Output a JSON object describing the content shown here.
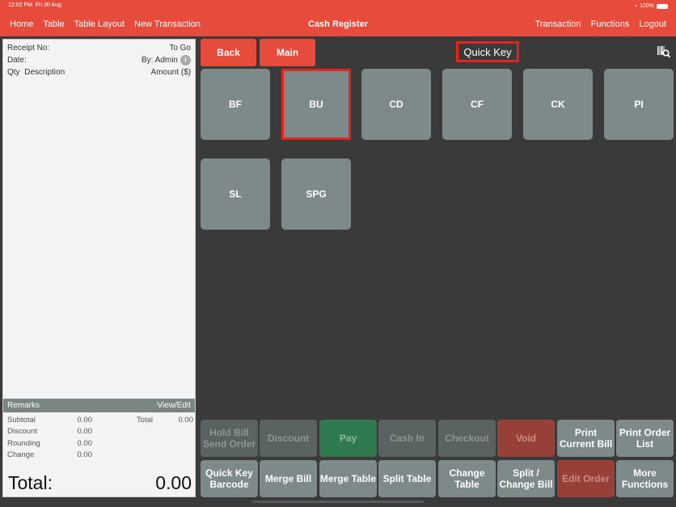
{
  "status_bar": {
    "time": "12:02 PM",
    "date": "Fri 30 Aug",
    "battery": "100%"
  },
  "nav": {
    "left": [
      "Home",
      "Table",
      "Table Layout",
      "New Transaction"
    ],
    "title": "Cash Register",
    "right": [
      "Transaction",
      "Functions",
      "Logout"
    ]
  },
  "receipt": {
    "receipt_no_label": "Receipt No:",
    "order_type": "To Go",
    "date_label": "Date:",
    "by": "By: Admin",
    "qty_label": "Qty",
    "desc_label": "Description",
    "amount_label": "Amount ($)",
    "remarks_label": "Remarks",
    "view_edit": "View/Edit",
    "subtotal_label": "Subtotal",
    "subtotal": "0.00",
    "discount_label": "Discount",
    "discount": "0.00",
    "rounding_label": "Rounding",
    "rounding": "0.00",
    "change_label": "Change",
    "change": "0.00",
    "total_small_label": "Total",
    "total_small": "0.00",
    "grand_total_label": "Total:",
    "grand_total": "0.00"
  },
  "toolbar": {
    "back": "Back",
    "main": "Main",
    "title": "Quick Key"
  },
  "quick_keys": [
    "BF",
    "BU",
    "CD",
    "CF",
    "CK",
    "PI",
    "SL",
    "SPG"
  ],
  "selected_key": "BU",
  "functions_row1": [
    "Hold Bill\nSend Order",
    "Discount",
    "Pay",
    "Cash In",
    "Checkout",
    "Void",
    "Print\nCurrent Bill",
    "Print Order\nList"
  ],
  "functions_row2": [
    "Quick Key\nBarcode",
    "Merge Bill",
    "Merge Table",
    "Split Table",
    "Change\nTable",
    "Split /\nChange Bill",
    "Edit Order",
    "More\nFunctions"
  ]
}
